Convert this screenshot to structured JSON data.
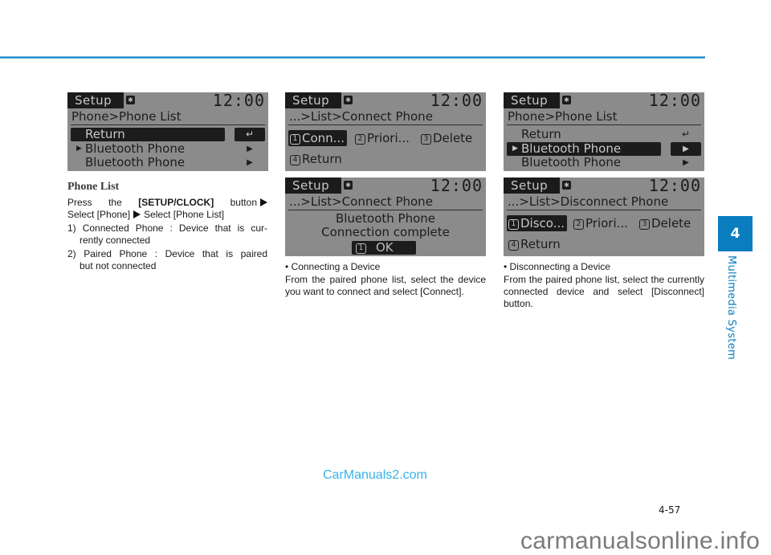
{
  "screens": {
    "phone_list_1": {
      "status": {
        "mode": "Setup",
        "clock": "12:00",
        "bt_icon": "bluetooth-icon"
      },
      "path": "Phone>Phone List",
      "rows": [
        {
          "label": "Return",
          "end": "↵",
          "selected": true
        },
        {
          "label": "Bluetooth Phone",
          "end": "▶",
          "connected": true
        },
        {
          "label": "Bluetooth Phone",
          "end": "▶"
        }
      ]
    },
    "connect_menu": {
      "status": {
        "mode": "Setup",
        "clock": "12:00"
      },
      "path": "...>List>Connect Phone",
      "options": [
        {
          "num": "1",
          "label": "Conn...",
          "selected": true
        },
        {
          "num": "2",
          "label": "Priori..."
        },
        {
          "num": "3",
          "label": "Delete"
        },
        {
          "num": "4",
          "label": "Return"
        }
      ]
    },
    "phone_list_2": {
      "status": {
        "mode": "Setup",
        "clock": "12:00"
      },
      "path": "Phone>Phone List",
      "rows": [
        {
          "label": "Return",
          "end": "↵"
        },
        {
          "label": "Bluetooth Phone",
          "end": "▶",
          "selected": true,
          "connected": true
        },
        {
          "label": "Bluetooth Phone",
          "end": "▶"
        }
      ]
    },
    "connect_complete": {
      "status": {
        "mode": "Setup",
        "clock": "12:00"
      },
      "path": "...>List>Connect Phone",
      "message_line1": "Bluetooth Phone",
      "message_line2": "Connection complete",
      "ok_num": "1",
      "ok_label": "OK"
    },
    "disconnect_menu": {
      "status": {
        "mode": "Setup",
        "clock": "12:00"
      },
      "path": "...>List>Disconnect Phone",
      "options": [
        {
          "num": "1",
          "label": "Disco...",
          "selected": true
        },
        {
          "num": "2",
          "label": "Priori..."
        },
        {
          "num": "3",
          "label": "Delete"
        },
        {
          "num": "4",
          "label": "Return"
        }
      ]
    }
  },
  "section": {
    "title": "Phone List",
    "press_the": "Press the",
    "button_name": "[SETUP/CLOCK]",
    "button_word": "button",
    "select_phone": "Select [Phone]",
    "select_list": "Select [Phone List]",
    "item1": "1) Connected Phone : Device that is currently connected",
    "item1_a": "1) Connected Phone : Device that is cur-",
    "item1_b": "rently connected",
    "item2_a": "2) Paired Phone : Device that is paired",
    "item2_b": "but not connected"
  },
  "connecting": {
    "bullet": "•  Connecting a Device",
    "body": "From the paired phone list, select the device you want to connect and select [Connect]."
  },
  "disconnecting": {
    "bullet": "•  Disconnecting a Device",
    "body": "From the paired phone list, select the currently connected device and select [Disconnect] button."
  },
  "chapter": {
    "number": "4",
    "title": "Multimedia System"
  },
  "page_number": "4-57",
  "watermarks": {
    "top": "CarManuals2.com",
    "bottom": "carmanualsonline.info"
  },
  "colors": {
    "accent": "#0a7dbf",
    "screen_bg": "#8b8b8b",
    "screen_dark": "#1c1c1c"
  }
}
